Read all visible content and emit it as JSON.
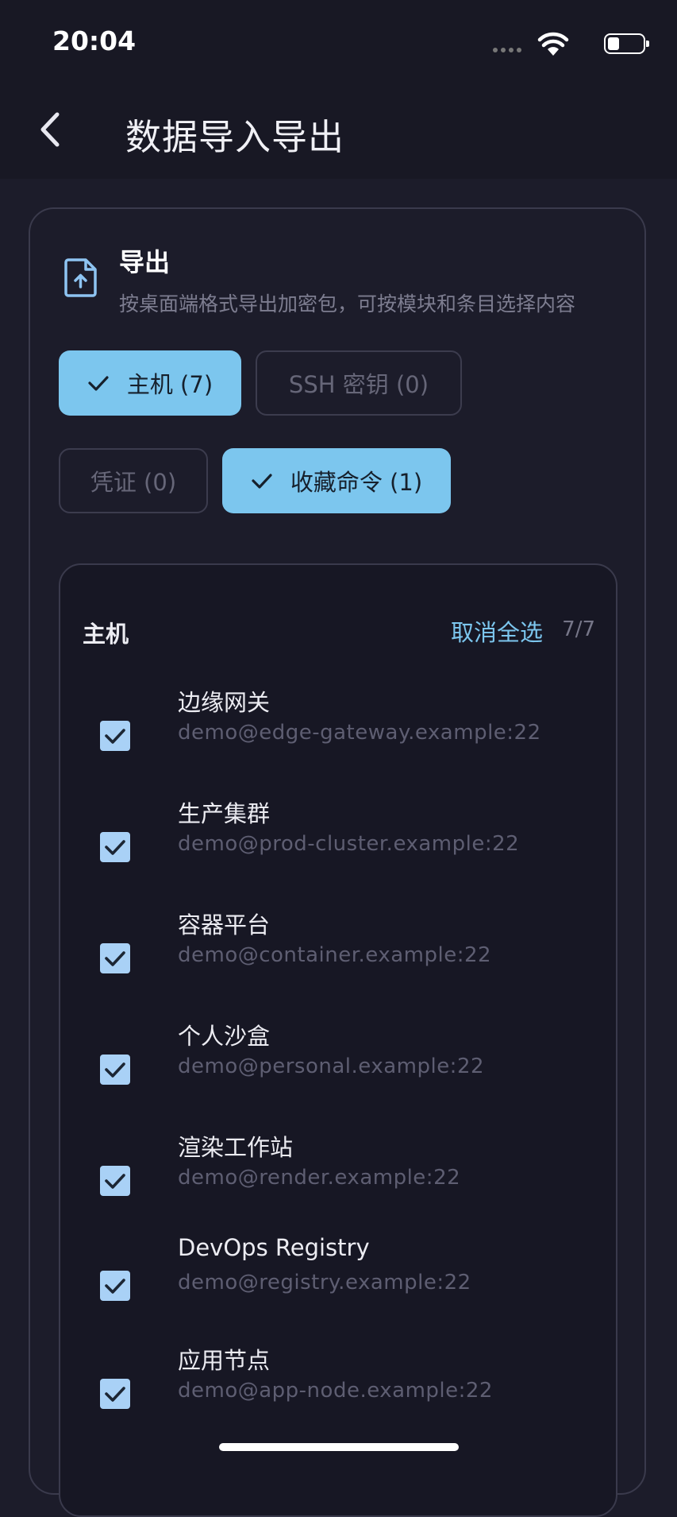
{
  "status_bar": {
    "time": "20:04",
    "icons": [
      "signal-icon",
      "wifi-icon",
      "battery-icon"
    ]
  },
  "header": {
    "back_icon": "chevron-left-icon",
    "title": "数据导入导出"
  },
  "export": {
    "icon": "file-upload-icon",
    "title": "导出",
    "description": "按桌面端格式导出加密包，可按模块和条目选择内容",
    "modules": [
      {
        "label": "主机 (7)",
        "selected": true
      },
      {
        "label": "SSH 密钥 (0)",
        "selected": false
      },
      {
        "label": "凭证 (0)",
        "selected": false
      },
      {
        "label": "收藏命令 (1)",
        "selected": true
      }
    ]
  },
  "hosts": {
    "heading": "主机",
    "deselect_all": "取消全选",
    "count": "7/7",
    "items": [
      {
        "name": "边缘网关",
        "address": "demo@edge-gateway.example:22",
        "checked": true
      },
      {
        "name": "生产集群",
        "address": "demo@prod-cluster.example:22",
        "checked": true
      },
      {
        "name": "容器平台",
        "address": "demo@container.example:22",
        "checked": true
      },
      {
        "name": "个人沙盒",
        "address": "demo@personal.example:22",
        "checked": true
      },
      {
        "name": "渲染工作站",
        "address": "demo@render.example:22",
        "checked": true
      },
      {
        "name": "DevOps Registry",
        "address": "demo@registry.example:22",
        "checked": true
      },
      {
        "name": "应用节点",
        "address": "demo@app-node.example:22",
        "checked": true
      }
    ]
  },
  "colors": {
    "background": "#1c1c2a",
    "accent": "#7cc6ee",
    "checkbox": "#a9d1f6",
    "muted_text": "#7d7d90"
  }
}
